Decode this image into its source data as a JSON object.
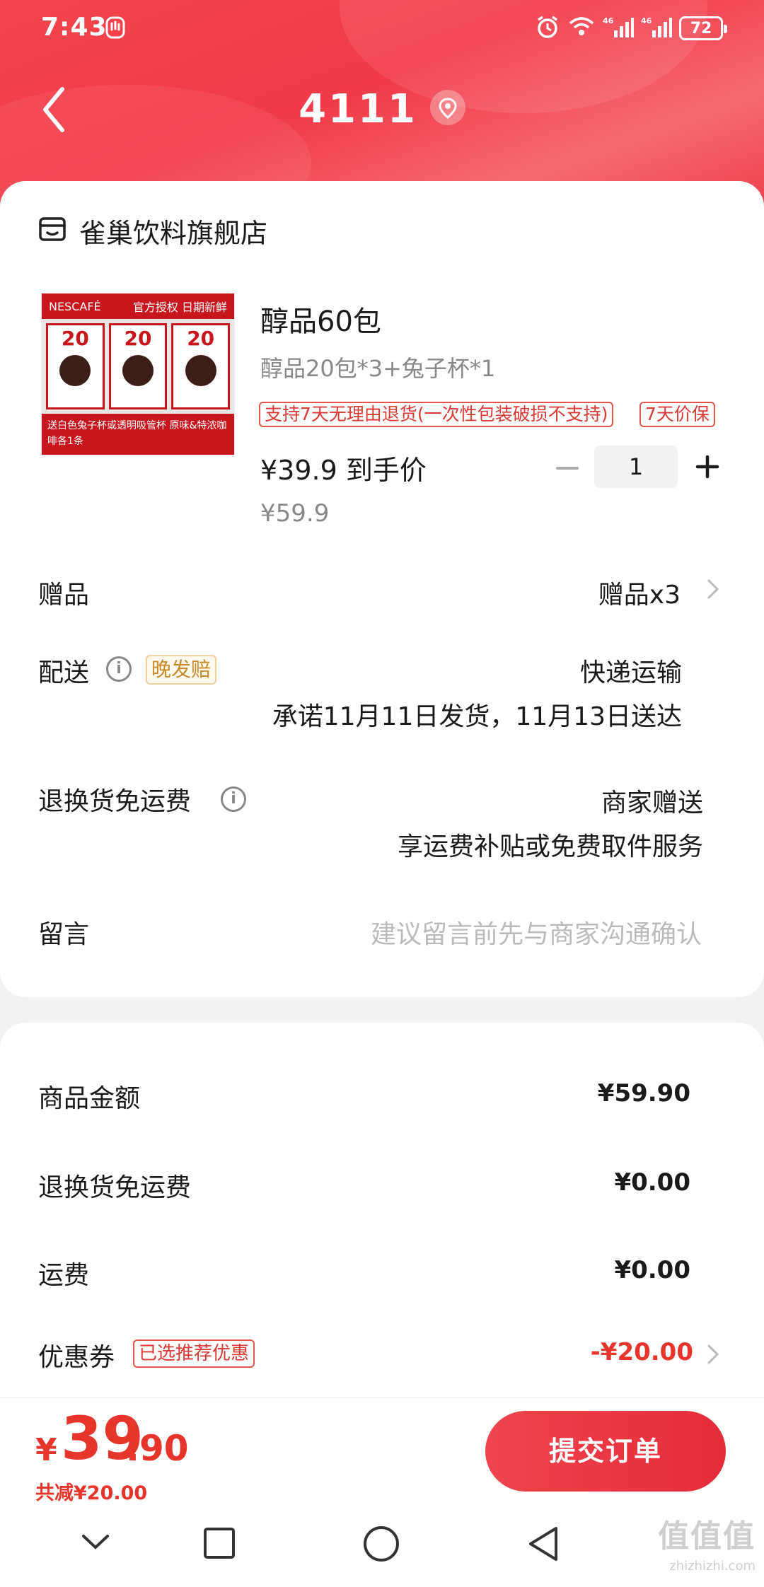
{
  "status": {
    "time": "7:43",
    "battery": "72",
    "net1": "46",
    "net2": "46"
  },
  "nav": {
    "title": "4111"
  },
  "store": {
    "name": "雀巢饮料旗舰店"
  },
  "product": {
    "image_top_left": "NESCAFÉ",
    "image_top_right": "官方授权 日期新鲜",
    "image_card_num": "20",
    "image_bottom_text": "送白色兔子杯或透明吸管杯 原味&特浓咖啡各1条",
    "title": "醇品60包",
    "spec": "醇品20包*3+兔子杯*1",
    "tag_return": "支持7天无理由退货(一次性包装破损不支持)",
    "tag_price": "7天价保",
    "price": "¥39.9 到手价",
    "original_price": "¥59.9",
    "quantity": "1"
  },
  "rows": {
    "gift": {
      "label": "赠品",
      "value": "赠品x3"
    },
    "delivery": {
      "label": "配送",
      "tag": "晚发赔",
      "value": "快递运输",
      "promise": "承诺11月11日发货，11月13日送达"
    },
    "return_shipping": {
      "label": "退换货免运费",
      "value": "商家赠送",
      "sub": "享运费补贴或免费取件服务"
    },
    "message": {
      "label": "留言",
      "placeholder": "建议留言前先与商家沟通确认"
    }
  },
  "summary": {
    "goods_amount": {
      "label": "商品金额",
      "value": "¥59.90"
    },
    "return_fee": {
      "label": "退换货免运费",
      "value": "¥0.00"
    },
    "shipping": {
      "label": "运费",
      "value": "¥0.00"
    },
    "coupon": {
      "label": "优惠券",
      "tag": "已选推荐优惠",
      "value": "-¥20.00"
    }
  },
  "footer": {
    "currency": "¥",
    "total_int": "39",
    "total_dec": ".90",
    "saved": "共减¥20.00",
    "submit": "提交订单"
  },
  "watermark": {
    "logo": "值值值",
    "url": "zhizhizhi.com"
  },
  "colors": {
    "brand_red": "#f23a48",
    "price_red": "#e8352c",
    "tag_orange": "#c88a2a"
  }
}
